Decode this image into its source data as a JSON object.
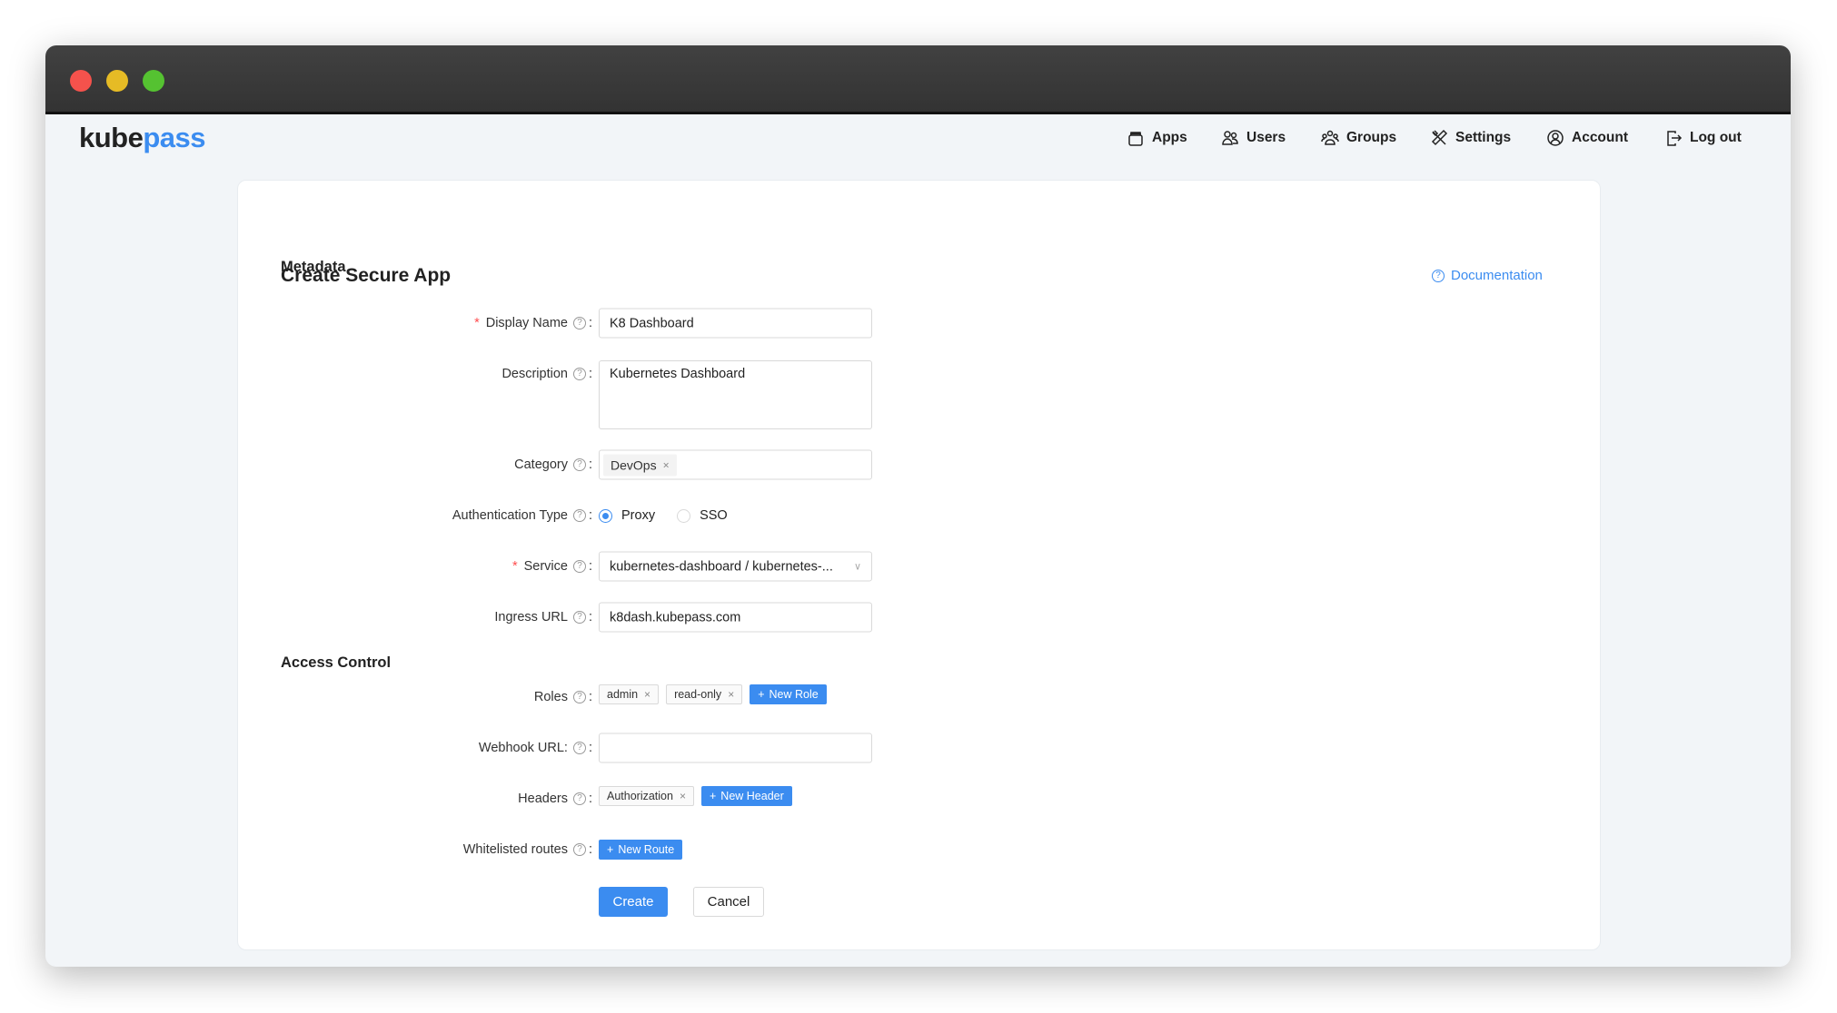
{
  "logo": {
    "part1": "kube",
    "part2": "pass"
  },
  "nav": [
    {
      "label": "Apps",
      "icon": "apps-icon"
    },
    {
      "label": "Users",
      "icon": "users-icon"
    },
    {
      "label": "Groups",
      "icon": "groups-icon"
    },
    {
      "label": "Settings",
      "icon": "settings-icon"
    },
    {
      "label": "Account",
      "icon": "account-icon"
    },
    {
      "label": "Log out",
      "icon": "logout-icon"
    }
  ],
  "page": {
    "title": "Create Secure App",
    "documentation": "Documentation"
  },
  "metadata": {
    "heading": "Metadata",
    "display_name": {
      "label": "Display Name",
      "value": "K8 Dashboard"
    },
    "description": {
      "label": "Description",
      "value": "Kubernetes Dashboard"
    },
    "category": {
      "label": "Category",
      "tags": [
        "DevOps"
      ]
    },
    "auth_type": {
      "label": "Authentication Type",
      "options": [
        "Proxy",
        "SSO"
      ],
      "selected": "Proxy"
    },
    "service": {
      "label": "Service",
      "value": "kubernetes-dashboard / kubernetes-..."
    },
    "ingress": {
      "label": "Ingress URL",
      "value": "k8dash.kubepass.com"
    }
  },
  "access": {
    "heading": "Access Control",
    "roles": {
      "label": "Roles",
      "tags": [
        "admin",
        "read-only"
      ],
      "add": "New Role"
    },
    "webhook": {
      "label": "Webhook URL:",
      "value": ""
    },
    "headers": {
      "label": "Headers",
      "tags": [
        "Authorization"
      ],
      "add": "New Header"
    },
    "routes": {
      "label": "Whitelisted routes",
      "add": "New Route"
    }
  },
  "actions": {
    "create": "Create",
    "cancel": "Cancel"
  },
  "colors": {
    "accent": "#3b8cf0",
    "required": "#ff4d4f"
  }
}
